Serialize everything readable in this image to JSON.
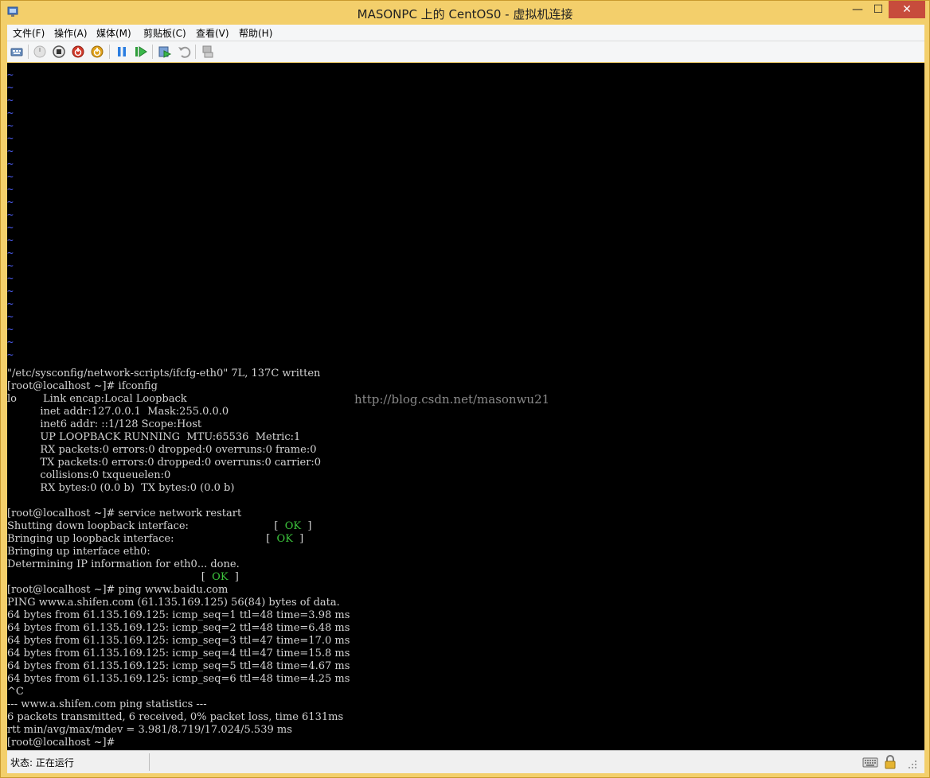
{
  "window": {
    "title": "MASONPC 上的 CentOS0 - 虚拟机连接",
    "min_glyph": "—",
    "max_glyph": "☐",
    "close_glyph": "✕"
  },
  "menu": {
    "file": "文件(F)",
    "action": "操作(A)",
    "media": "媒体(M)",
    "clipboard": "剪贴板(C)",
    "view": "查看(V)",
    "help": "帮助(H)"
  },
  "toolbar": {
    "icons": [
      "ctrl-alt-del-icon",
      "start-icon",
      "turn-off-icon",
      "shutdown-icon",
      "save-icon",
      "pause-icon",
      "reset-icon",
      "checkpoint-icon",
      "revert-icon",
      "enhanced-session-icon"
    ]
  },
  "console": {
    "tilde": "~",
    "lines": [
      "\"/etc/sysconfig/network-scripts/ifcfg-eth0\" 7L, 137C written",
      "[root@localhost ~]# ifconfig",
      "lo        Link encap:Local Loopback",
      "          inet addr:127.0.0.1  Mask:255.0.0.0",
      "          inet6 addr: ::1/128 Scope:Host",
      "          UP LOOPBACK RUNNING  MTU:65536  Metric:1",
      "          RX packets:0 errors:0 dropped:0 overruns:0 frame:0",
      "          TX packets:0 errors:0 dropped:0 overruns:0 carrier:0",
      "          collisions:0 txqueuelen:0",
      "          RX bytes:0 (0.0 b)  TX bytes:0 (0.0 b)",
      "",
      "[root@localhost ~]# service network restart",
      "Shutting down loopback interface:",
      "Bringing up loopback interface:",
      "Bringing up interface eth0:",
      "Determining IP information for eth0... done.",
      "",
      "[root@localhost ~]# ping www.baidu.com",
      "PING www.a.shifen.com (61.135.169.125) 56(84) bytes of data.",
      "64 bytes from 61.135.169.125: icmp_seq=1 ttl=48 time=3.98 ms",
      "64 bytes from 61.135.169.125: icmp_seq=2 ttl=48 time=6.48 ms",
      "64 bytes from 61.135.169.125: icmp_seq=3 ttl=47 time=17.0 ms",
      "64 bytes from 61.135.169.125: icmp_seq=4 ttl=47 time=15.8 ms",
      "64 bytes from 61.135.169.125: icmp_seq=5 ttl=48 time=4.67 ms",
      "64 bytes from 61.135.169.125: icmp_seq=6 ttl=48 time=4.25 ms",
      "^C",
      "--- www.a.shifen.com ping statistics ---",
      "6 packets transmitted, 6 received, 0% packet loss, time 6131ms",
      "rtt min/avg/max/mdev = 3.981/8.719/17.024/5.539 ms",
      "[root@localhost ~]#"
    ],
    "ok_label": "OK",
    "ok_lines": [
      12,
      13,
      16
    ],
    "watermark": "http://blog.csdn.net/masonwu21",
    "tilde_color": "#4b5cf0",
    "ok_color": "#3cc43c"
  },
  "status": {
    "text": "状态: 正在运行",
    "icons": [
      "keyboard-icon",
      "lock-icon",
      "resize-grip-icon"
    ]
  },
  "colors": {
    "title_bar": "#f3cf6b",
    "close_button": "#c74c3c",
    "console_bg": "#000000"
  }
}
